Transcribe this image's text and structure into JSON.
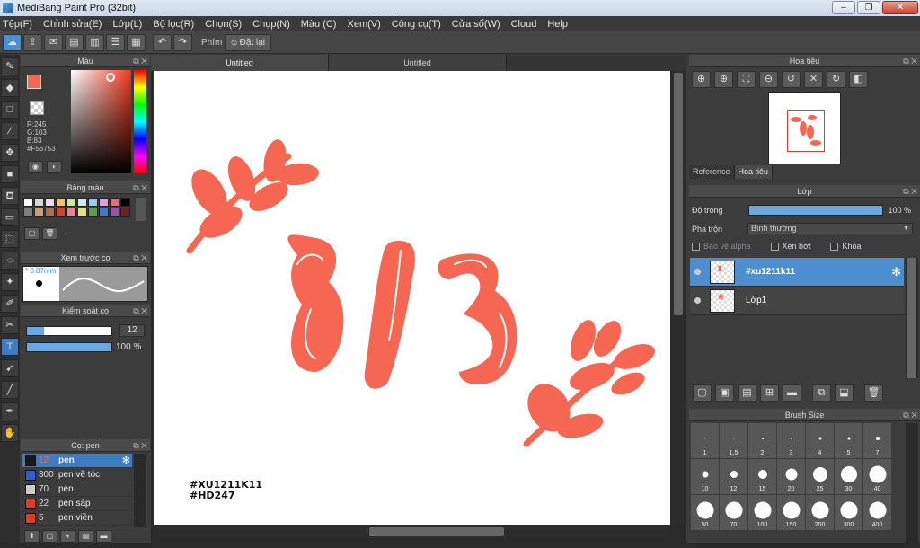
{
  "window": {
    "title": "MediBang Paint Pro (32bit)",
    "minimize": "‒",
    "maximize": "❐",
    "close": "✕"
  },
  "menu": [
    "Tệp(F)",
    "Chỉnh sửa(E)",
    "Lớp(L)",
    "Bộ lọc(R)",
    "Chọn(S)",
    "Chụp(N)",
    "Màu (C)",
    "Xem(V)",
    "Công cụ(T)",
    "Cửa sổ(W)",
    "Cloud",
    "Help"
  ],
  "toolbar": {
    "phim_label": "Phím",
    "reset_label": "Đặt lại"
  },
  "color_panel": {
    "title": "Màu",
    "r": "R:245",
    "g": "G:103",
    "b": "B:83",
    "hex": "#F56753",
    "fg_color": "#f56753"
  },
  "palette_panel": {
    "title": "Bảng màu",
    "swatches": [
      "#ffffff",
      "#d6d6d6",
      "#f3d6f0",
      "#f0c36a",
      "#c9e7a4",
      "#c8ecf0",
      "#9cc9ee",
      "#e0a0d8",
      "#e07080",
      "#000000",
      "#7f7f7f",
      "#c9a070",
      "#b07050",
      "#d84030",
      "#f08090",
      "#e8e080",
      "#60a040",
      "#3a7ad0",
      "#a050b0",
      "#702020"
    ],
    "dash": "---"
  },
  "brush_preview": {
    "title": "Xem trước cọ",
    "size": "* 0.87mm"
  },
  "brush_control": {
    "title": "Kiểm soát cọ",
    "size_value": "12",
    "opacity_value": "100 %",
    "size_fill": 0.2,
    "opacity_fill": 1.0
  },
  "brush_panel": {
    "title": "Cọ: pen",
    "items": [
      {
        "color": "#1a1a1a",
        "size": "12",
        "name": "pen",
        "selected": true
      },
      {
        "color": "#2f5bd8",
        "size": "300",
        "name": "pen vẽ tóc",
        "selected": false
      },
      {
        "color": "#cfcfcf",
        "size": "70",
        "name": "pen",
        "selected": false
      },
      {
        "color": "#e03b2a",
        "size": "22",
        "name": "pen sáp",
        "selected": false
      },
      {
        "color": "#e03b2a",
        "size": "5",
        "name": "pen viền",
        "selected": false
      }
    ]
  },
  "canvas": {
    "tabs": [
      "Untitled",
      "Untitled"
    ],
    "hashtag1": "#XU1211K11",
    "hashtag2": "#HD247",
    "art_color": "#f56753"
  },
  "navigator": {
    "title": "Hoa tiêu",
    "tabs": [
      "Reference",
      "Hoa tiêu"
    ]
  },
  "layer_panel": {
    "title": "Lớp",
    "opacity_label": "Độ trong",
    "opacity_value": "100 %",
    "blend_label": "Pha trộn",
    "blend_value": "Bình thường",
    "protect_alpha": "Bảo vệ alpha",
    "clipping": "Xén bớt",
    "lock": "Khóa",
    "layers": [
      {
        "name": "#xu1211k11",
        "selected": true
      },
      {
        "name": "Lớp1",
        "selected": false
      }
    ]
  },
  "brush_size": {
    "title": "Brush Size",
    "sizes": [
      {
        "label": "1",
        "d": 1
      },
      {
        "label": "1.5",
        "d": 1
      },
      {
        "label": "2",
        "d": 2
      },
      {
        "label": "3",
        "d": 2
      },
      {
        "label": "4",
        "d": 3
      },
      {
        "label": "5",
        "d": 3
      },
      {
        "label": "7",
        "d": 4
      },
      {
        "label": "10",
        "d": 7
      },
      {
        "label": "12",
        "d": 8
      },
      {
        "label": "15",
        "d": 10
      },
      {
        "label": "20",
        "d": 13
      },
      {
        "label": "25",
        "d": 16
      },
      {
        "label": "30",
        "d": 18
      },
      {
        "label": "40",
        "d": 19
      },
      {
        "label": "50",
        "d": 19
      },
      {
        "label": "70",
        "d": 19
      },
      {
        "label": "100",
        "d": 19
      },
      {
        "label": "150",
        "d": 19
      },
      {
        "label": "200",
        "d": 19
      },
      {
        "label": "300",
        "d": 19
      },
      {
        "label": "400",
        "d": 19
      }
    ]
  }
}
